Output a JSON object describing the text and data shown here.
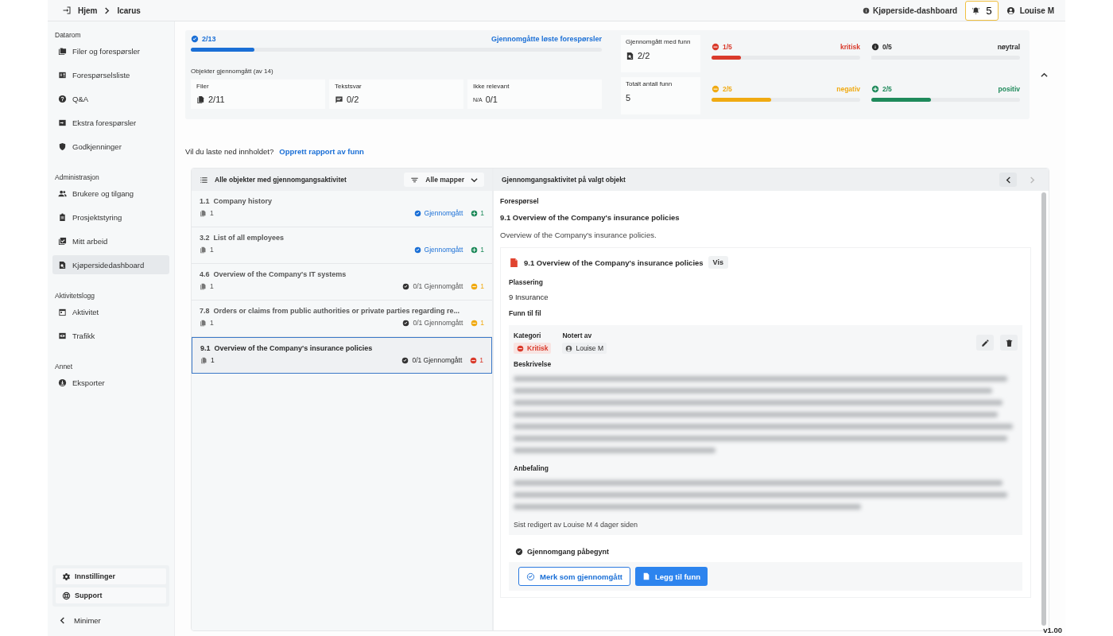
{
  "breadcrumb": [
    {
      "label": "Hjem"
    },
    {
      "label": "Icarus"
    }
  ],
  "header": {
    "dashboard_link": "Kjøperside-dashboard",
    "notifications": "5",
    "user": "Louise M"
  },
  "sidebar": {
    "sections": [
      {
        "title": "Datarom",
        "items": [
          {
            "label": "Filer og forespørsler",
            "selected": false
          },
          {
            "label": "Forespørselsliste",
            "selected": false
          },
          {
            "label": "Q&A",
            "selected": false
          },
          {
            "label": "Ekstra forespørsler",
            "selected": false
          },
          {
            "label": "Godkjenninger",
            "selected": false
          }
        ]
      },
      {
        "title": "Administrasjon",
        "items": [
          {
            "label": "Brukere og tilgang",
            "selected": false
          },
          {
            "label": "Prosjektstyring",
            "selected": false
          },
          {
            "label": "Mitt arbeid",
            "selected": false
          },
          {
            "label": "Kjøpersidedashboard",
            "selected": true
          }
        ]
      },
      {
        "title": "Aktivitetslogg",
        "items": [
          {
            "label": "Aktivitet",
            "selected": false
          },
          {
            "label": "Trafikk",
            "selected": false
          }
        ]
      },
      {
        "title": "Annet",
        "items": [
          {
            "label": "Eksporter",
            "selected": false
          }
        ]
      }
    ],
    "footer_items": [
      {
        "label": "Innstillinger"
      },
      {
        "label": "Support"
      }
    ],
    "minimize": "Minimer"
  },
  "progress": {
    "count": "2/13",
    "level": 0.154,
    "link": "Gjennomgåtte løste forespørsler",
    "objects_title": "Objekter gjennomgått (av 14)",
    "stats": [
      {
        "kind": "files",
        "label": "Filer",
        "value": "2/11"
      },
      {
        "kind": "text",
        "label": "Tekstsvar",
        "value": "0/2"
      },
      {
        "kind": "na",
        "label": "Ikke relevant",
        "prefix": "N/A",
        "value": "0/1"
      }
    ]
  },
  "findings": {
    "reviewed": {
      "label": "Gjennomgått med funn",
      "value": "2/2"
    },
    "total": {
      "label": "Totalt antall funn",
      "value": "5"
    },
    "meters": [
      {
        "kind": "critical",
        "count": "1/5",
        "label": "kritisk",
        "level": 0.2,
        "color": "#d93a2b"
      },
      {
        "kind": "neutral",
        "count": "0/5",
        "label": "nøytral",
        "level": 0,
        "color": "#2b2b2b"
      },
      {
        "kind": "negative",
        "count": "2/5",
        "label": "negativ",
        "level": 0.4,
        "color": "#f0aa12"
      },
      {
        "kind": "positive",
        "count": "2/5",
        "label": "positiv",
        "level": 0.4,
        "color": "#1f8a5b"
      }
    ]
  },
  "download": {
    "question": "Vil du laste ned innholdet?",
    "link": "Opprett rapport av funn"
  },
  "list": {
    "title": "Alle objekter med gjennomgangsaktivitet",
    "filter": "Alle mapper",
    "items": [
      {
        "number": "1.1",
        "title": "Company history",
        "files": "1",
        "status": "Gjennomgått",
        "reviewed": true,
        "kind": "positive",
        "finding_count": "1",
        "selected": false
      },
      {
        "number": "3.2",
        "title": "List of all employees",
        "files": "1",
        "status": "Gjennomgått",
        "reviewed": true,
        "kind": "positive",
        "finding_count": "1",
        "selected": false
      },
      {
        "number": "4.6",
        "title": "Overview of the Company's IT systems",
        "files": "1",
        "status": "0/1 Gjennomgått",
        "reviewed": false,
        "kind": "negative",
        "finding_count": "1",
        "selected": false
      },
      {
        "number": "7.8",
        "title": "Orders or claims from public authorities or private parties regarding re...",
        "files": "1",
        "status": "0/1 Gjennomgått",
        "reviewed": false,
        "kind": "negative",
        "finding_count": "1",
        "selected": false
      },
      {
        "number": "9.1",
        "title": "Overview of the Company's insurance policies",
        "files": "1",
        "status": "0/1 Gjennomgått",
        "reviewed": false,
        "kind": "critical",
        "finding_count": "1",
        "selected": true
      }
    ]
  },
  "detail": {
    "title": "Gjennomgangsaktivitet på valgt objekt",
    "prev_disabled": false,
    "next_disabled": true,
    "request_label": "Forespørsel",
    "request_title": "9.1 Overview of the Company's insurance policies",
    "request_text": "Overview of the Company's insurance policies.",
    "file": {
      "name": "9.1 Overview of the Company's insurance policies",
      "view": "Vis",
      "location_label": "Plassering",
      "location": "9 Insurance",
      "findings_label": "Funn til fil",
      "finding": {
        "category_label": "Kategori",
        "category": "Kritisk",
        "kind": "critical",
        "noted_label": "Notert av",
        "noted_by": "Louise M",
        "description_label": "Beskrivelse",
        "recommendation_label": "Anbefaling",
        "edited": "Sist redigert av Louise M 4 dager siden"
      }
    },
    "review_status": "Gjennomgang påbegynt",
    "buttons": [
      {
        "kind": "outline",
        "label": "Merk som gjennomgått"
      },
      {
        "kind": "primary",
        "label": "Legg til funn"
      }
    ]
  },
  "version": "v1.00"
}
